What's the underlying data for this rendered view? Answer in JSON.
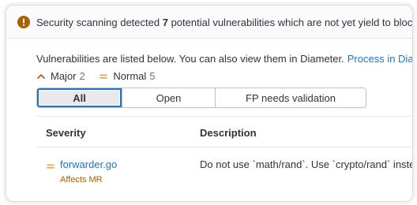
{
  "header": {
    "icon": "warning-icon",
    "text_before": "Security scanning detected ",
    "count": "7",
    "text_after": " potential vulnerabilities which are not yet yield to blocking",
    "icon_color": "#ab6100"
  },
  "intro": {
    "text": "Vulnerabilities are listed below. You can also view them in Diameter.",
    "link_label": "Process in Diameter",
    "link_icon": "external-link-icon"
  },
  "counts": [
    {
      "label": "Major",
      "value": "2",
      "icon": "chevron-up-icon",
      "color": "#c8481c"
    },
    {
      "label": "Normal",
      "value": "5",
      "icon": "equals-icon",
      "color": "#e9a23b"
    }
  ],
  "filters": [
    {
      "label": "All",
      "selected": true
    },
    {
      "label": "Open",
      "selected": false
    },
    {
      "label": "FP needs validation",
      "selected": false
    }
  ],
  "table": {
    "columns": [
      "Severity",
      "Description"
    ],
    "rows": [
      {
        "severity_icon": "equals-icon",
        "file": "forwarder.go",
        "affects": "Affects MR",
        "description": "Do not use `math/rand`. Use `crypto/rand` instead."
      }
    ]
  },
  "colors": {
    "link": "#1f75cb",
    "accent_focus": "#1f75cb",
    "affects": "#ab6100"
  }
}
